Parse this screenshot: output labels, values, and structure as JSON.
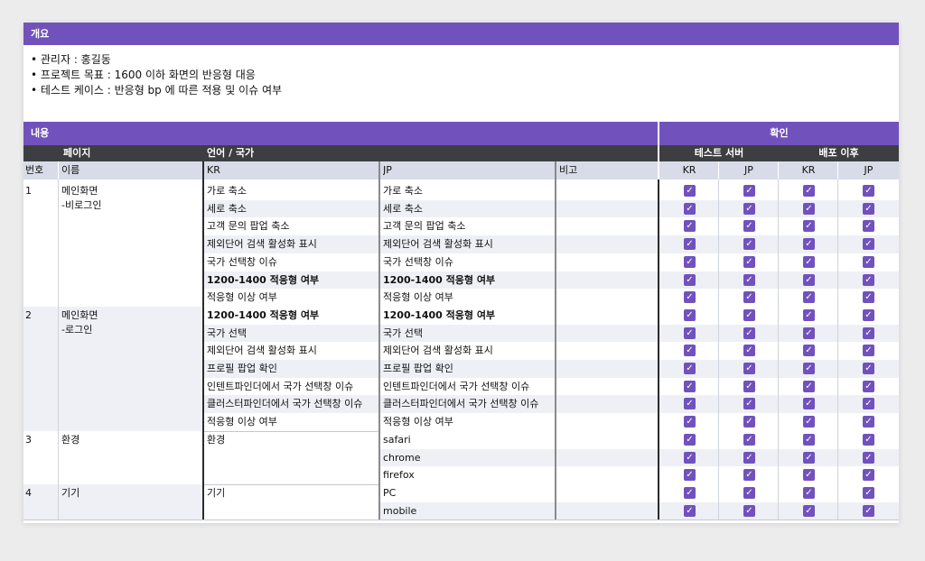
{
  "overview": {
    "title": "개요",
    "lines": [
      "• 관리자 : 홍길동",
      "• 프로젝트 목표 : 1600 이하 화면의 반응형 대응",
      "• 테스트 케이스 : 반응형 bp 에 따른 적용 및 이슈 여부"
    ]
  },
  "table": {
    "section_content": "내용",
    "section_confirm": "확인",
    "col_page": "페이지",
    "col_lang": "언어 / 국가",
    "col_test_server": "테스트 서버",
    "col_after_deploy": "배포 이후",
    "h_no": "번호",
    "h_name": "이름",
    "h_kr": "KR",
    "h_jp": "JP",
    "h_note": "비고",
    "h_c1": "KR",
    "h_c2": "JP",
    "h_c3": "KR",
    "h_c4": "JP",
    "checkbox_color": "#7152bd",
    "groups": [
      {
        "no": "1",
        "name": [
          "메인화면",
          "-비로그인"
        ],
        "rows": [
          {
            "kr": "가로 축소",
            "jp": "가로 축소",
            "bold": false
          },
          {
            "kr": "세로 축소",
            "jp": "세로 축소",
            "bold": false
          },
          {
            "kr": "고객 문의 팝업 축소",
            "jp": "고객 문의 팝업 축소",
            "bold": false
          },
          {
            "kr": "제외단어 검색 활성화 표시",
            "jp": "제외단어 검색 활성화 표시",
            "bold": false
          },
          {
            "kr": "국가 선택창 이슈",
            "jp": "국가 선택창 이슈",
            "bold": false
          },
          {
            "kr": "1200-1400 적응형 여부",
            "jp": "1200-1400 적응형 여부",
            "bold": true
          },
          {
            "kr": "적응형 이상 여부",
            "jp": "적응형 이상 여부",
            "bold": false
          }
        ]
      },
      {
        "no": "2",
        "name": [
          "메인화면",
          "-로그인"
        ],
        "rows": [
          {
            "kr": "1200-1400 적응형 여부",
            "jp": "1200-1400 적응형 여부",
            "bold": true
          },
          {
            "kr": "국가 선택",
            "jp": "국가 선택",
            "bold": false
          },
          {
            "kr": "제외단어 검색 활성화 표시",
            "jp": "제외단어 검색 활성화 표시",
            "bold": false
          },
          {
            "kr": "프로필 팝업 확인",
            "jp": "프로필 팝업 확인",
            "bold": false
          },
          {
            "kr": "인텐트파인더에서 국가 선택창 이슈",
            "jp": "인텐트파인더에서 국가 선택창 이슈",
            "bold": false
          },
          {
            "kr": "클러스터파인더에서 국가 선택창 이슈",
            "jp": "클러스터파인더에서 국가 선택창 이슈",
            "bold": false
          },
          {
            "kr": "적응형 이상 여부",
            "jp": "적응형 이상 여부",
            "bold": false
          }
        ]
      },
      {
        "no": "3",
        "name": [
          "환경"
        ],
        "kr_merged": "환경",
        "rows": [
          {
            "kr": "",
            "jp": "safari",
            "bold": false
          },
          {
            "kr": "",
            "jp": "chrome",
            "bold": false
          },
          {
            "kr": "",
            "jp": "firefox",
            "bold": false
          }
        ]
      },
      {
        "no": "4",
        "name": [
          "기기"
        ],
        "kr_merged": "기기",
        "rows": [
          {
            "kr": "",
            "jp": "PC",
            "bold": false
          },
          {
            "kr": "",
            "jp": "mobile",
            "bold": false
          }
        ]
      }
    ]
  }
}
